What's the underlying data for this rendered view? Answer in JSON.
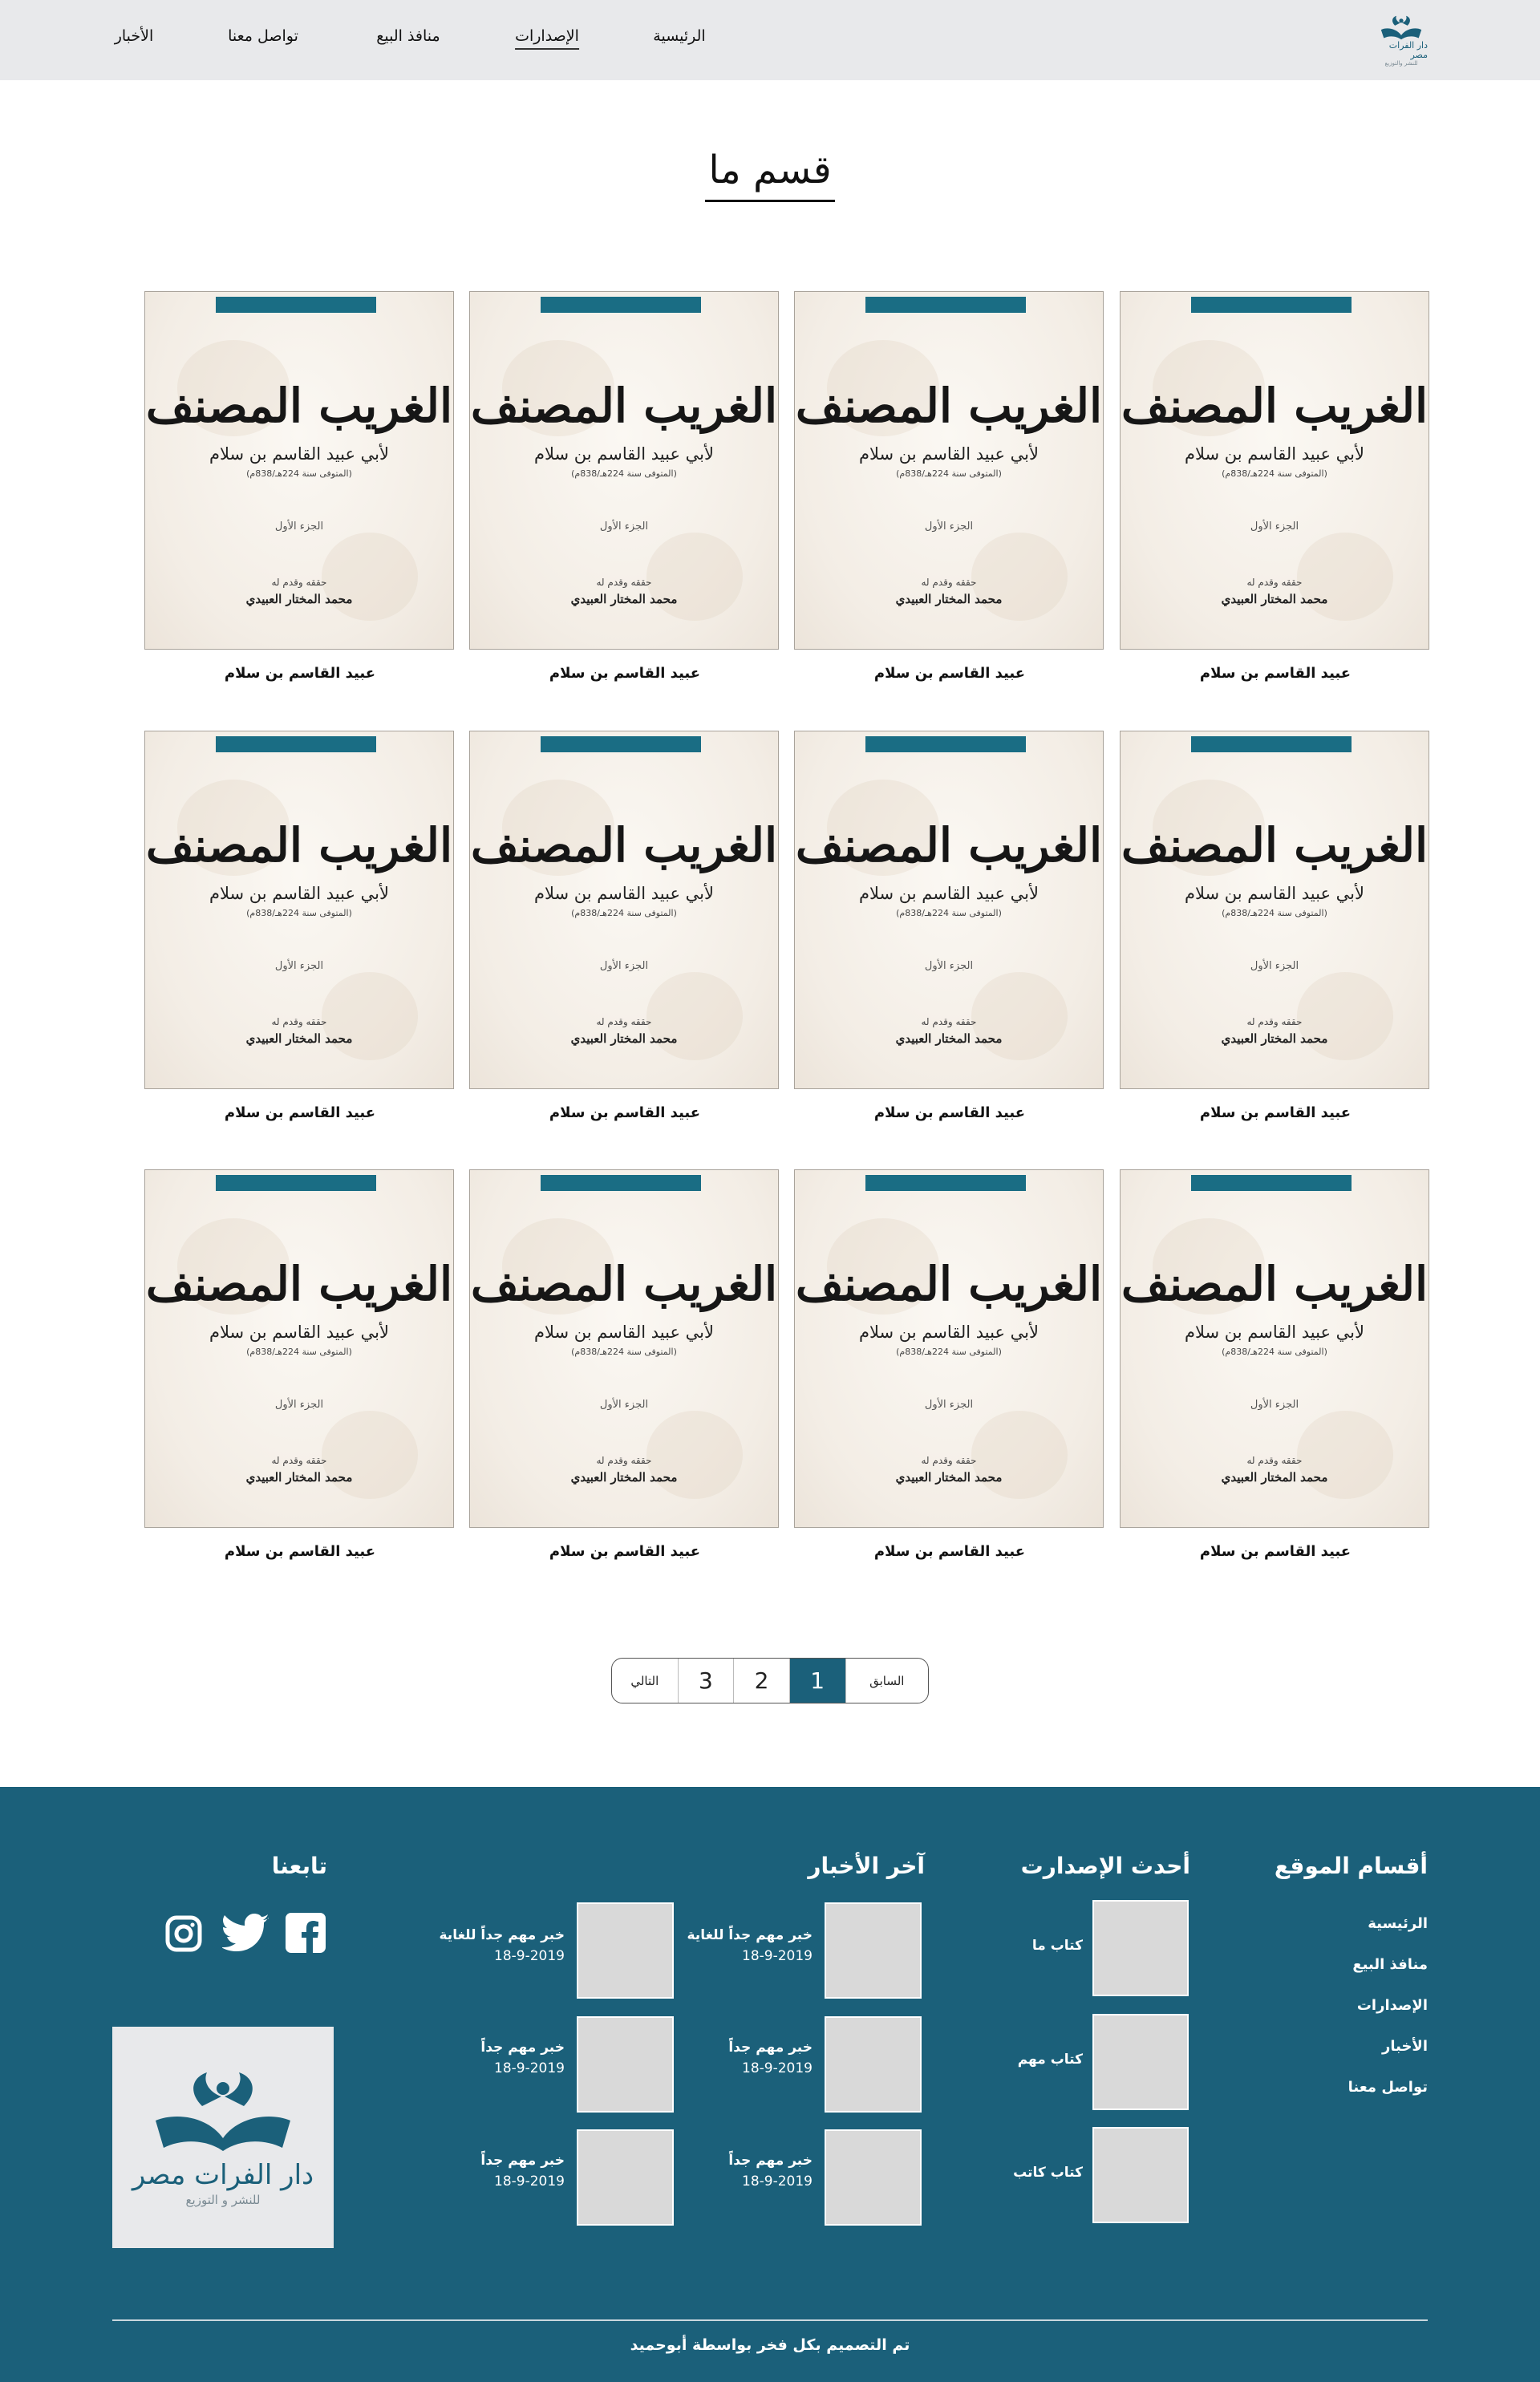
{
  "header": {
    "logo_text": "دار الفرات مصر",
    "logo_subtext": "للنشر والتوزيع",
    "nav": [
      {
        "label": "الرئيسية"
      },
      {
        "label": "الإصدارات"
      },
      {
        "label": "منافذ البيع"
      },
      {
        "label": "تواصل معنا"
      },
      {
        "label": "الأخبار"
      }
    ],
    "active_nav": "الإصدارات"
  },
  "section": {
    "title": "قسم ما"
  },
  "book_cover": {
    "title": "الغريب المصنف",
    "author": "لأبي عبيد القاسم بن سلام",
    "death": "(المتوفى سنة 224هـ/838م)",
    "part": "الجزء الأول",
    "editor_label": "حققه وقدم له",
    "editor": "محمد المختار العبيدي"
  },
  "books": [
    {
      "caption": "عبيد القاسم بن سلام"
    },
    {
      "caption": "عبيد القاسم بن سلام"
    },
    {
      "caption": "عبيد القاسم بن سلام"
    },
    {
      "caption": "عبيد القاسم بن سلام"
    },
    {
      "caption": "عبيد القاسم بن سلام"
    },
    {
      "caption": "عبيد القاسم بن سلام"
    },
    {
      "caption": "عبيد القاسم بن سلام"
    },
    {
      "caption": "عبيد القاسم بن سلام"
    },
    {
      "caption": "عبيد القاسم بن سلام"
    },
    {
      "caption": "عبيد القاسم بن سلام"
    },
    {
      "caption": "عبيد القاسم بن سلام"
    },
    {
      "caption": "عبيد القاسم بن سلام"
    }
  ],
  "pagination": {
    "prev_label": "السابق",
    "pages": [
      "1",
      "2",
      "3"
    ],
    "current": "1",
    "next_label": "التالي"
  },
  "footer": {
    "sections_heading": "أقسام الموقع",
    "sections": [
      "الرئيسية",
      "منافذ البيع",
      "الإصدارات",
      "الأخبار",
      "تواصل معنا"
    ],
    "releases_heading": "أحدث الإصدارت",
    "releases": [
      {
        "title": "كتاب ما"
      },
      {
        "title": "كتاب مهم"
      },
      {
        "title": "كتاب كاتب"
      }
    ],
    "news_heading": "آخر الأخبار",
    "news_col1": [
      {
        "title": "خبر مهم جداً للغاية",
        "date": "18-9-2019"
      },
      {
        "title": "خبر مهم جداً",
        "date": "18-9-2019"
      },
      {
        "title": "خبر مهم جداً",
        "date": "18-9-2019"
      }
    ],
    "news_col2": [
      {
        "title": "خبر مهم جداً للغاية",
        "date": "18-9-2019"
      },
      {
        "title": "خبر مهم جداً",
        "date": "18-9-2019"
      },
      {
        "title": "خبر مهم جداً",
        "date": "18-9-2019"
      }
    ],
    "follow_heading": "تابعنا",
    "social": [
      {
        "icon": "facebook-icon"
      },
      {
        "icon": "twitter-icon"
      },
      {
        "icon": "instagram-icon"
      }
    ],
    "logo_text": "دار الفرات مصر",
    "logo_subtext": "للنشر و التوزيع",
    "copyright": "تم التصميم بكل فخر بواسطة أبوحميد"
  },
  "colors": {
    "brand": "#1b607a",
    "header_bg": "#e8e9eb",
    "thumb_bg": "#d9d9d9"
  }
}
